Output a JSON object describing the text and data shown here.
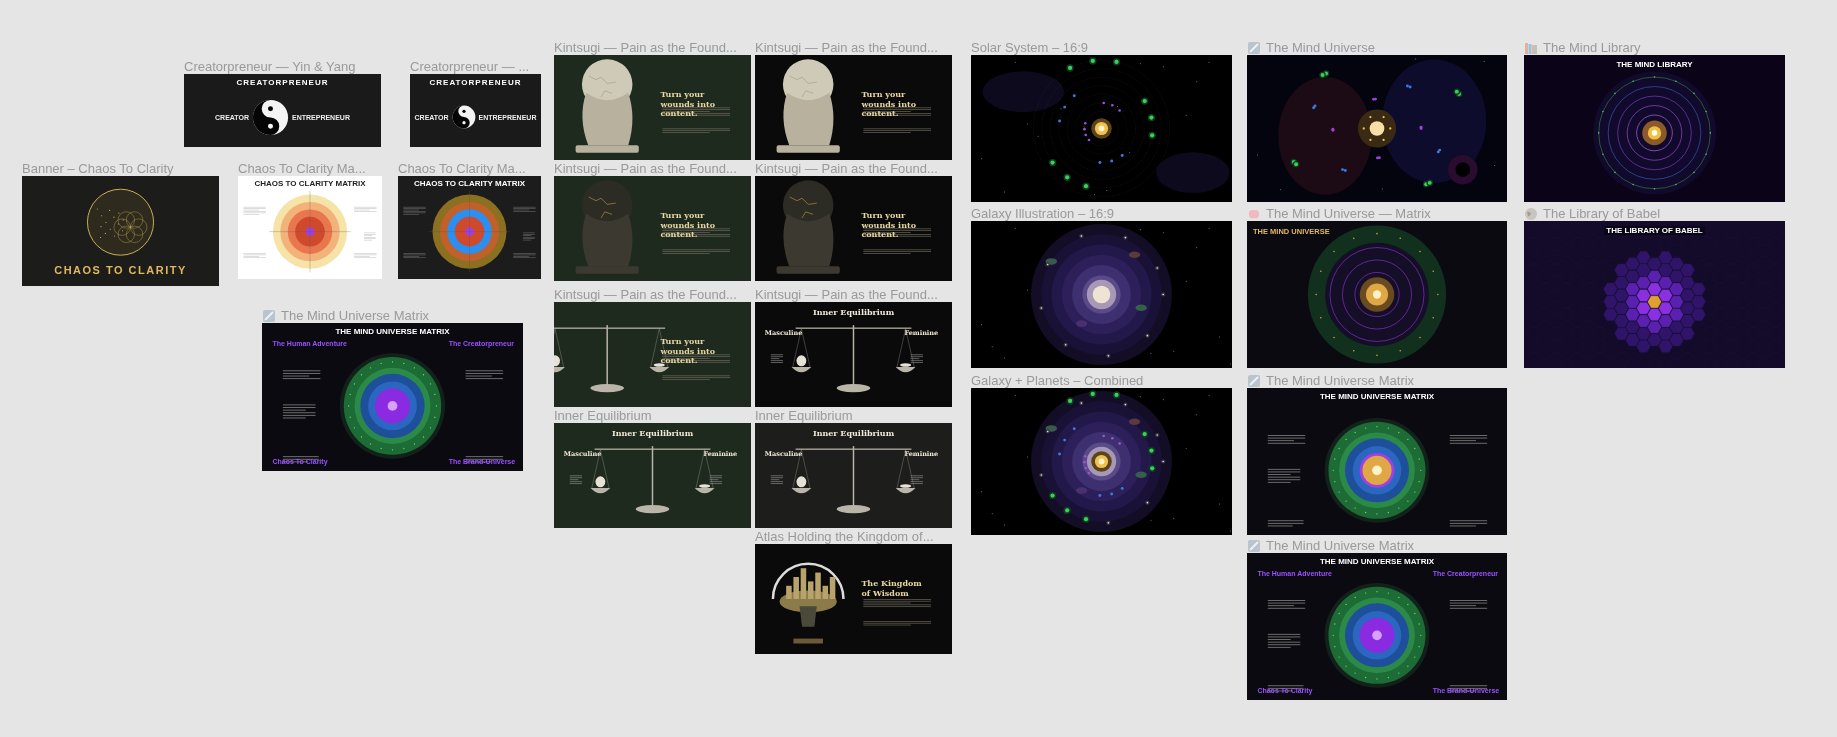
{
  "canvas": {
    "frames": [
      {
        "title": "Creatorpreneur — Yin & Yang",
        "preview": {
          "kind": "yinyang",
          "title": "CREATORPRENEUR",
          "left_label": "CREATOR",
          "right_label": "ENTREPRENEUR"
        }
      },
      {
        "title": "Creatorpreneur — ...",
        "preview": {
          "kind": "yinyang",
          "title": "CREATORPRENEUR",
          "left_label": "CREATOR",
          "right_label": "ENTREPRENEUR"
        }
      },
      {
        "title": "Banner – Chaos To Clarity",
        "preview": {
          "kind": "banner",
          "title": "CHAOS TO CLARITY"
        }
      },
      {
        "title": "Chaos To Clarity Ma...",
        "preview": {
          "kind": "target-matrix",
          "title": "CHAOS TO CLARITY MATRIX"
        }
      },
      {
        "title": "Chaos To Clarity Ma...",
        "preview": {
          "kind": "target-matrix",
          "title": "CHAOS TO CLARITY MATRIX"
        }
      },
      {
        "title": "The Mind Universe Matrix",
        "preview": {
          "kind": "mind-matrix",
          "title": "THE MIND UNIVERSE MATRIX",
          "corners": [
            "The Human Adventure",
            "The Creatorpreneur",
            "Chaos To Clarity",
            "The Brand-Universe"
          ]
        }
      },
      {
        "title": "Kintsugi — Pain as the Found...",
        "preview": {
          "kind": "kintsugi",
          "heading": "Turn your wounds into content."
        }
      },
      {
        "title": "Kintsugi — Pain as the Found...",
        "preview": {
          "kind": "kintsugi",
          "heading": "Turn your wounds into content."
        }
      },
      {
        "title": "Kintsugi — Pain as the Found...",
        "preview": {
          "kind": "kintsugi",
          "heading": "Turn your wounds into content."
        }
      },
      {
        "title": "Kintsugi — Pain as the Found...",
        "preview": {
          "kind": "kintsugi",
          "heading": "Turn your wounds into content."
        }
      },
      {
        "title": "Kintsugi — Pain as the Found...",
        "preview": {
          "kind": "kintsugi",
          "heading": "Turn your wounds into content."
        }
      },
      {
        "title": "Kintsugi — Pain as the Found...",
        "preview": {
          "kind": "equilibrium",
          "title": "Inner Equilibrium",
          "left_label": "Masculine",
          "right_label": "Feminine"
        }
      },
      {
        "title": "Inner Equilibrium",
        "preview": {
          "kind": "equilibrium",
          "title": "Inner Equilibrium",
          "left_label": "Masculine",
          "right_label": "Feminine"
        }
      },
      {
        "title": "Inner Equilibrium",
        "preview": {
          "kind": "equilibrium",
          "title": "Inner Equilibrium",
          "left_label": "Masculine",
          "right_label": "Feminine"
        }
      },
      {
        "title": "Atlas Holding the Kingdom of...",
        "preview": {
          "kind": "kintsugi",
          "heading": "The Kingdom of Wisdom"
        }
      },
      {
        "title": "Solar System – 16:9",
        "preview": {
          "kind": "solar"
        }
      },
      {
        "title": "The Mind Universe",
        "preview": {
          "kind": "universe"
        }
      },
      {
        "title": "The Mind Library",
        "preview": {
          "kind": "library",
          "title": "THE MIND LIBRARY"
        }
      },
      {
        "title": "Galaxy Illustration – 16:9",
        "preview": {
          "kind": "galaxy"
        }
      },
      {
        "title": "The Mind Universe — Matrix",
        "preview": {
          "kind": "universe-circle",
          "title": "THE MIND UNIVERSE"
        }
      },
      {
        "title": "The Library of Babel",
        "preview": {
          "kind": "babel",
          "title": "THE LIBRARY OF BABEL"
        }
      },
      {
        "title": "Galaxy + Planets – Combined",
        "preview": {
          "kind": "combined"
        }
      },
      {
        "title": "The Mind Universe Matrix",
        "preview": {
          "kind": "mind-matrix",
          "title": "THE MIND UNIVERSE MATRIX"
        }
      },
      {
        "title": "The Mind Universe Matrix",
        "preview": {
          "kind": "mind-matrix",
          "title": "THE MIND UNIVERSE MATRIX",
          "corners": [
            "The Human Adventure",
            "The Creatorpreneur",
            "Chaos To Clarity",
            "The Brand-Universe"
          ]
        }
      }
    ]
  }
}
